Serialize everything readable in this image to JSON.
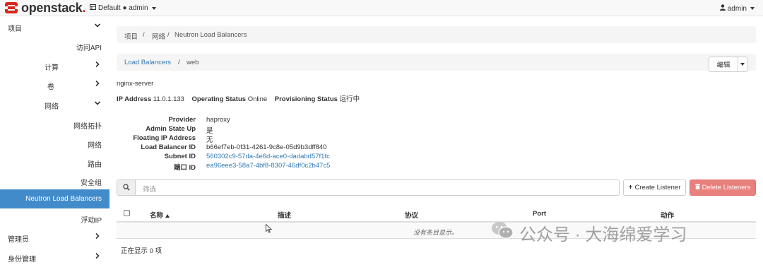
{
  "topbar": {
    "brand": "openstack",
    "brand_dot": ".",
    "project": "Default ● admin",
    "user": "admin"
  },
  "sidebar": {
    "items": [
      {
        "label": "项目",
        "chevron": "chevron-down-icon"
      },
      {
        "label": "访问API"
      },
      {
        "label": "计算",
        "chevron": "chevron-right-icon"
      },
      {
        "label": "卷",
        "chevron": "chevron-right-icon"
      },
      {
        "label": "网络",
        "chevron": "chevron-down-icon"
      },
      {
        "label": "网络拓扑"
      },
      {
        "label": "网络"
      },
      {
        "label": "路由"
      },
      {
        "label": "安全组"
      },
      {
        "label": "Neutron Load Balancers",
        "active": true
      },
      {
        "label": "浮动IP"
      },
      {
        "label": "管理员",
        "chevron": "chevron-right-icon"
      },
      {
        "label": "身份管理",
        "chevron": "chevron-right-icon"
      }
    ]
  },
  "breadcrumb": {
    "items": [
      "项目",
      "网络",
      "Neutron Load Balancers"
    ],
    "separator": "/"
  },
  "sub_breadcrumb": {
    "link": "Load Balancers",
    "separator": "/",
    "current": "web"
  },
  "actions": {
    "edit": "编辑"
  },
  "summary": {
    "name": "nginx-server",
    "ip_label": "IP Address",
    "ip_value": "11.0.1.133",
    "op_label": "Operating Status",
    "op_value": "Online",
    "prov_label": "Provisioning Status",
    "prov_value": "运行中"
  },
  "details": [
    {
      "label": "Provider",
      "value": "haproxy",
      "link": false
    },
    {
      "label": "Admin State Up",
      "value": "是",
      "link": false
    },
    {
      "label": "Floating IP Address",
      "value": "无",
      "link": false
    },
    {
      "label": "Load Balancer ID",
      "value": "b66ef7eb-0f31-4261-9c8e-05d9b3dff840",
      "link": false
    },
    {
      "label": "Subnet ID",
      "value": "560302c9-57da-4e6d-ace0-dadabd57f1fc",
      "link": true
    },
    {
      "label": "端口 ID",
      "value": "ea96eee3-58a7-4bf8-8307-46df0c2b47c5",
      "link": true
    }
  ],
  "listeners": {
    "filter_placeholder": "筛选",
    "create_label": "Create Listener",
    "delete_label": "Delete Listeners",
    "columns": [
      "名称",
      "描述",
      "协议",
      "Port",
      "动作"
    ],
    "empty_text": "没有条目显示。",
    "footer": "正在显示 0 项"
  },
  "watermark": {
    "text": "公众号 · 大海绵爱学习"
  },
  "colors": {
    "brand_red": "#d9261c",
    "active_blue": "#428bca",
    "link_blue": "#337ab7",
    "danger": "#e8807d"
  }
}
